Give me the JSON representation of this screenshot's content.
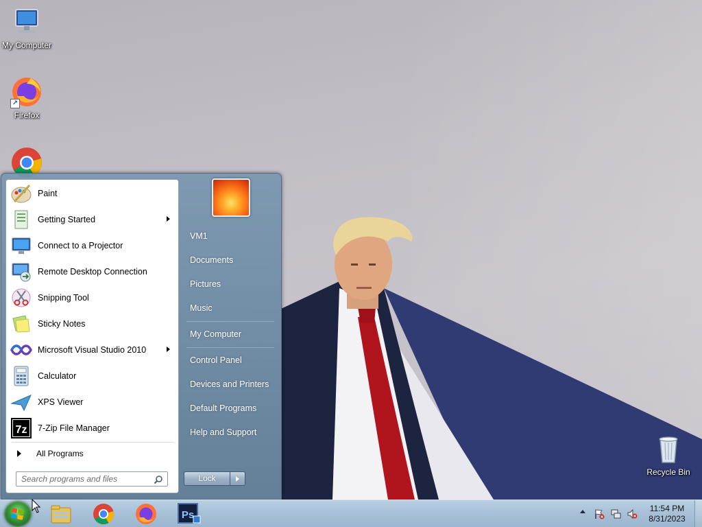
{
  "desktop": {
    "icons": [
      {
        "label": "My Computer"
      },
      {
        "label": "Firefox"
      },
      {
        "label": "Recycle Bin"
      }
    ]
  },
  "start_menu": {
    "programs": [
      {
        "label": "Paint",
        "icon": "paint-icon",
        "has_submenu": false
      },
      {
        "label": "Getting Started",
        "icon": "getting-started-icon",
        "has_submenu": true
      },
      {
        "label": "Connect to a Projector",
        "icon": "projector-icon",
        "has_submenu": false
      },
      {
        "label": "Remote Desktop Connection",
        "icon": "remote-desktop-icon",
        "has_submenu": false
      },
      {
        "label": "Snipping Tool",
        "icon": "scissors-icon",
        "has_submenu": false
      },
      {
        "label": "Sticky Notes",
        "icon": "sticky-notes-icon",
        "has_submenu": false
      },
      {
        "label": "Microsoft Visual Studio 2010",
        "icon": "visual-studio-icon",
        "has_submenu": true
      },
      {
        "label": "Calculator",
        "icon": "calculator-icon",
        "has_submenu": false
      },
      {
        "label": "XPS Viewer",
        "icon": "xps-viewer-icon",
        "has_submenu": false
      },
      {
        "label": "7-Zip File Manager",
        "icon": "7zip-icon",
        "has_submenu": false
      }
    ],
    "all_programs_label": "All Programs",
    "search_placeholder": "Search programs and files",
    "right_items": [
      {
        "label": "VM1"
      },
      {
        "label": "Documents"
      },
      {
        "label": "Pictures"
      },
      {
        "label": "Music"
      },
      {
        "label": "My Computer"
      },
      {
        "label": "Control Panel"
      },
      {
        "label": "Devices and Printers"
      },
      {
        "label": "Default Programs"
      },
      {
        "label": "Help and Support"
      }
    ],
    "shutdown_label": "Lock"
  },
  "taskbar": {
    "pinned": [
      "windows-explorer-icon",
      "chrome-icon",
      "firefox-icon",
      "photoshop-icon"
    ],
    "photoshop_text": "Ps",
    "seven_zip_text": "7z",
    "clock_time": "11:54 PM",
    "clock_date": "8/31/2023"
  },
  "colors": {
    "wallpaper": "#c3bfc6",
    "start_menu_frame": "#6f8ea9",
    "taskbar": "#a7c0d7",
    "tie": "#b0141c",
    "suit": "#1c2440"
  }
}
